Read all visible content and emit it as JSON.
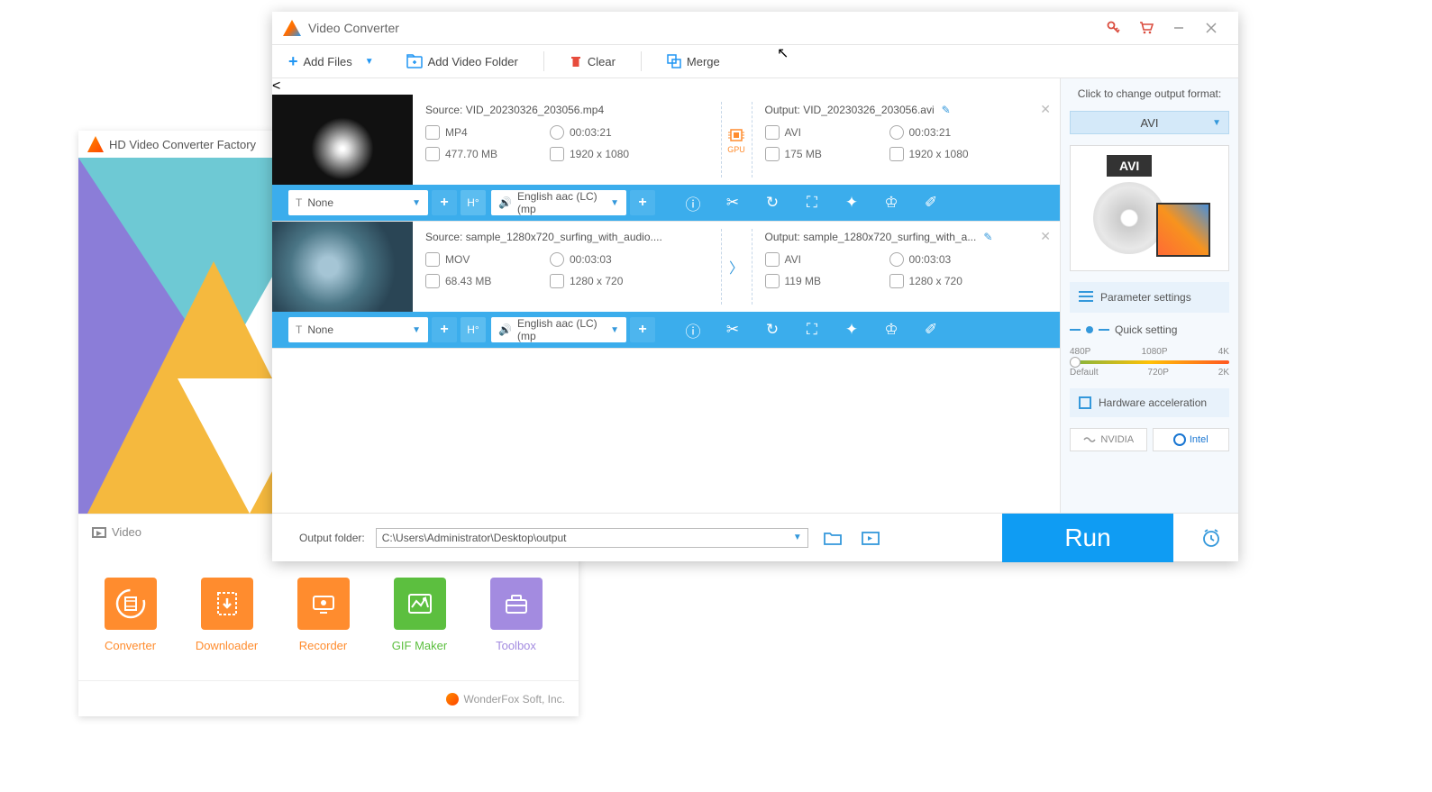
{
  "launcher": {
    "title": "HD Video Converter Factory",
    "tab": "Video",
    "tiles": [
      {
        "label": "Converter"
      },
      {
        "label": "Downloader"
      },
      {
        "label": "Recorder"
      },
      {
        "label": "GIF Maker"
      },
      {
        "label": "Toolbox"
      }
    ],
    "footer": "WonderFox Soft, Inc."
  },
  "converter": {
    "title": "Video Converter",
    "toolbar": {
      "add_files": "Add Files",
      "add_folder": "Add Video Folder",
      "clear": "Clear",
      "merge": "Merge"
    },
    "items": [
      {
        "source_label": "Source: VID_20230326_203056.mp4",
        "output_label": "Output: VID_20230326_203056.avi",
        "src_fmt": "MP4",
        "src_dur": "00:03:21",
        "src_size": "477.70 MB",
        "src_res": "1920 x 1080",
        "out_fmt": "AVI",
        "out_dur": "00:03:21",
        "out_size": "175 MB",
        "out_res": "1920 x 1080",
        "gpu": true,
        "subtitle": "None",
        "audio": "English aac (LC) (mp"
      },
      {
        "source_label": "Source: sample_1280x720_surfing_with_audio....",
        "output_label": "Output: sample_1280x720_surfing_with_a...",
        "src_fmt": "MOV",
        "src_dur": "00:03:03",
        "src_size": "68.43 MB",
        "src_res": "1280 x 720",
        "out_fmt": "AVI",
        "out_dur": "00:03:03",
        "out_size": "119 MB",
        "out_res": "1280 x 720",
        "gpu": false,
        "subtitle": "None",
        "audio": "English aac (LC) (mp"
      }
    ],
    "side": {
      "click_label": "Click to change output format:",
      "format": "AVI",
      "format_badge": "AVI",
      "param": "Parameter settings",
      "quick": "Quick setting",
      "ticks_top": [
        "480P",
        "1080P",
        "4K"
      ],
      "ticks_bottom": [
        "Default",
        "720P",
        "2K"
      ],
      "hw": "Hardware acceleration",
      "chip_nvidia": "NVIDIA",
      "chip_intel": "Intel"
    },
    "bottom": {
      "label": "Output folder:",
      "path": "C:\\Users\\Administrator\\Desktop\\output",
      "run": "Run"
    }
  }
}
